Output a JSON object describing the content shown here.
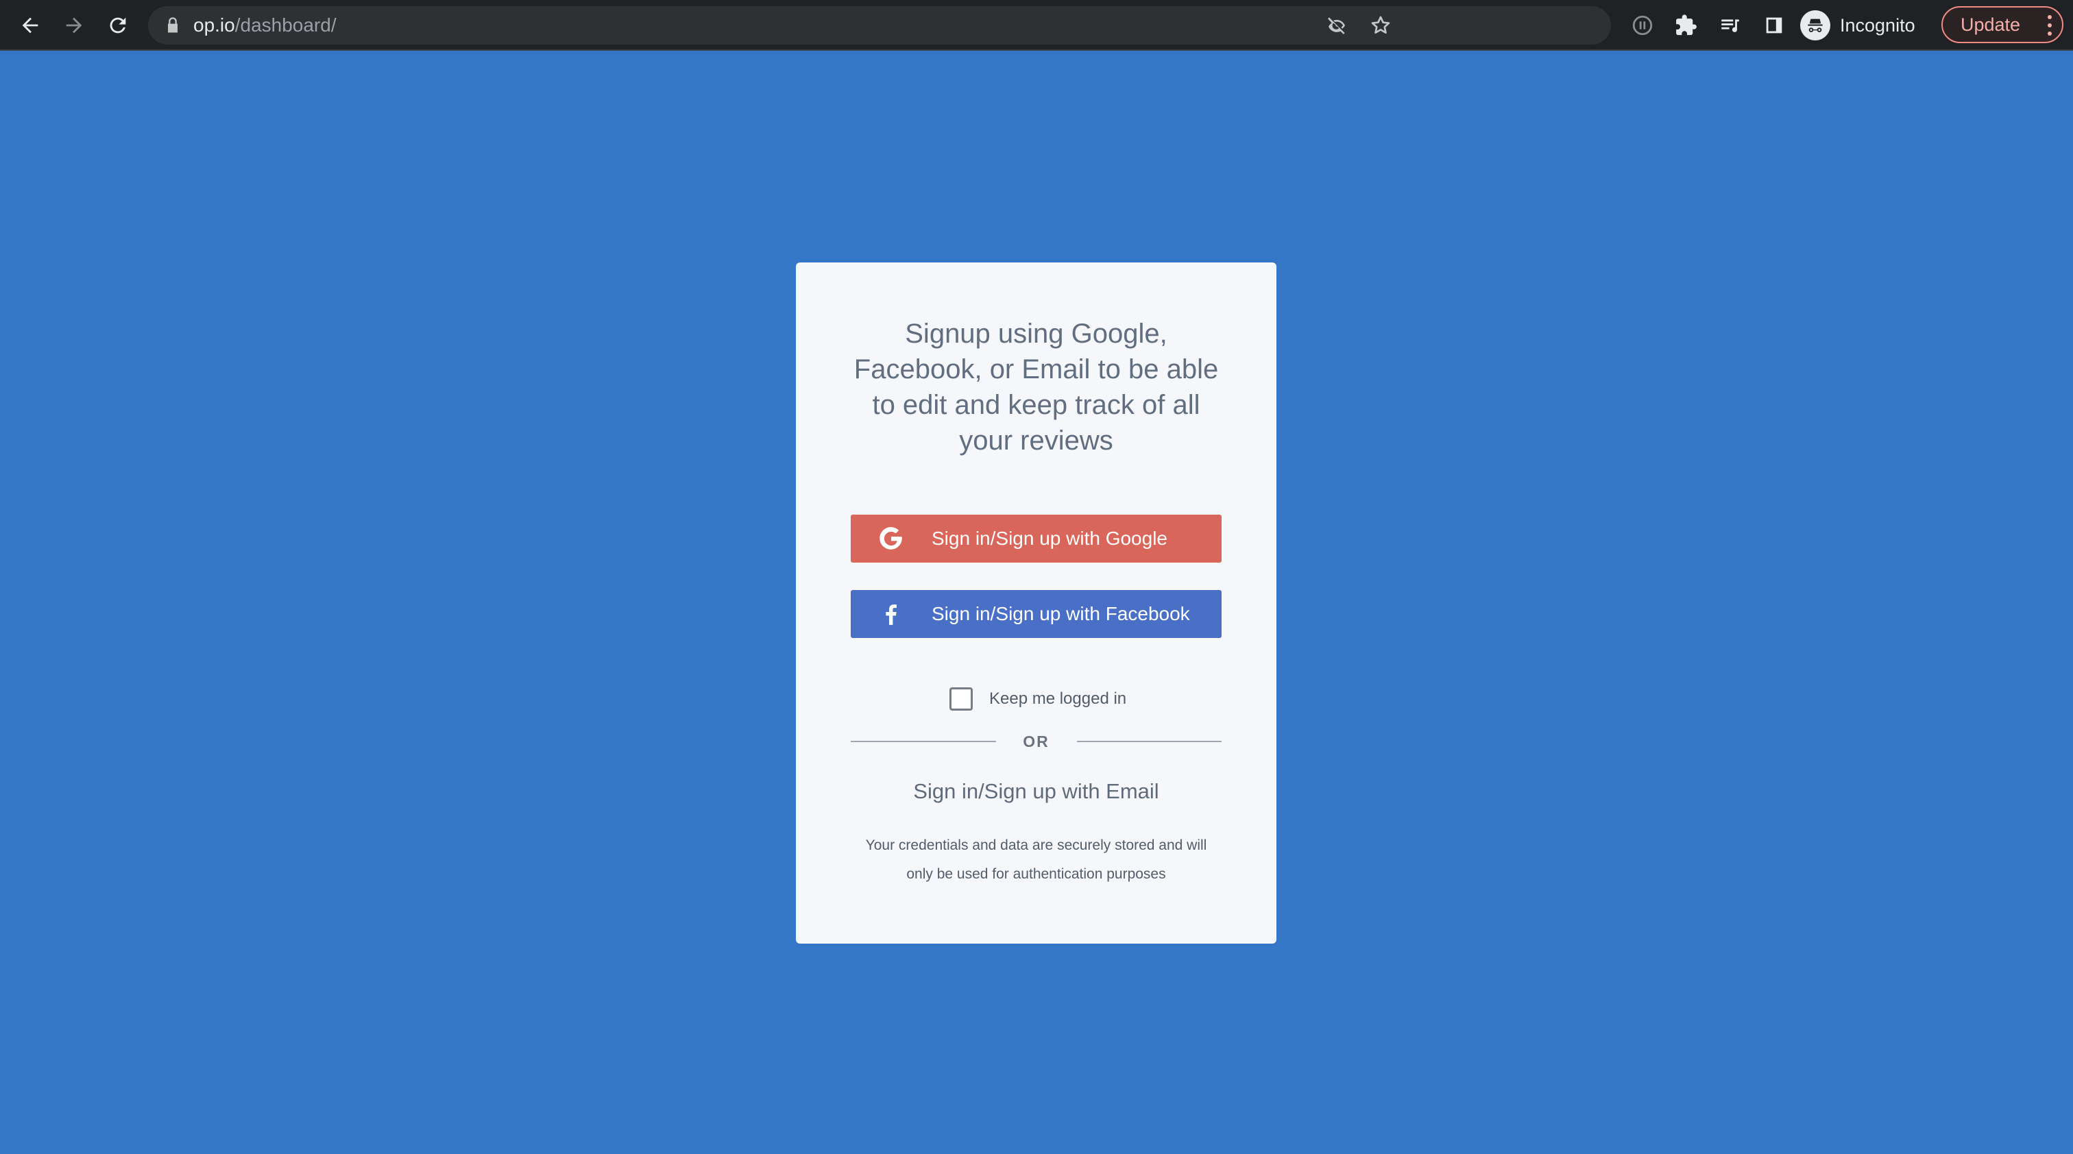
{
  "browser": {
    "url_host": "op.io",
    "url_path": "/dashboard/",
    "profile_label": "Incognito",
    "update_label": "Update",
    "icons": [
      "back-icon",
      "forward-icon",
      "reload-icon",
      "lock-icon",
      "eye-off-icon",
      "star-icon",
      "pause-icon",
      "puzzle-icon",
      "reading-list-icon",
      "side-panel-icon",
      "incognito-icon",
      "more-vert-icon"
    ]
  },
  "signup_card": {
    "headline": "Signup using Google, Facebook, or Email to be able to edit and keep track of all your reviews",
    "google_label": "Sign in/Sign up with Google",
    "facebook_label": "Sign in/Sign up with Facebook",
    "keep_logged_in_label": "Keep me logged in",
    "or_label": "OR",
    "email_label": "Sign in/Sign up with Email",
    "disclaimer": "Your credentials and data are securely stored and will only be used for authentication purposes"
  },
  "colors": {
    "page_background": "#3477c6",
    "google_button": "#d8665a",
    "facebook_button": "#4a6fc6",
    "card_background": "#f5f7fa"
  }
}
